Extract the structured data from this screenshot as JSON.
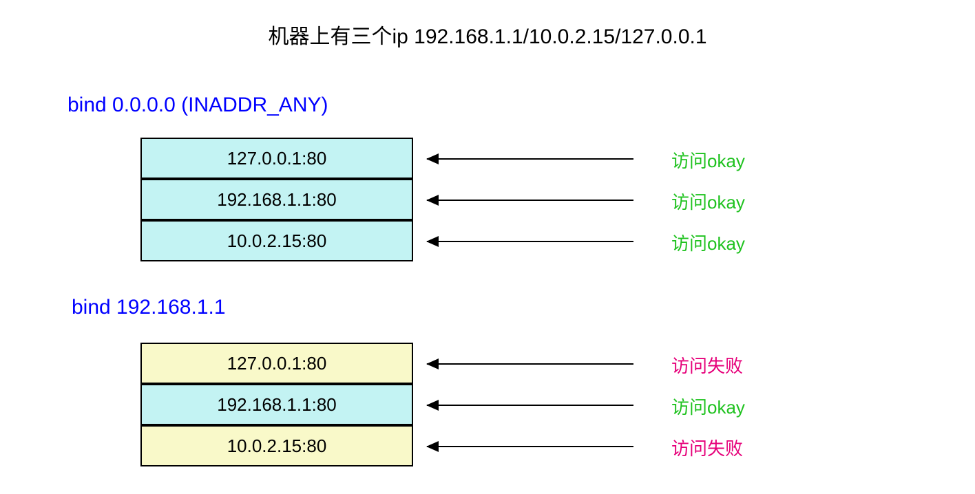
{
  "title": "机器上有三个ip 192.168.1.1/10.0.2.15/127.0.0.1",
  "section1": {
    "heading": "bind 0.0.0.0 (INADDR_ANY)",
    "rows": [
      {
        "addr": "127.0.0.1:80",
        "status": "访问okay",
        "ok": true
      },
      {
        "addr": "192.168.1.1:80",
        "status": "访问okay",
        "ok": true
      },
      {
        "addr": "10.0.2.15:80",
        "status": "访问okay",
        "ok": true
      }
    ]
  },
  "section2": {
    "heading": "bind 192.168.1.1",
    "rows": [
      {
        "addr": "127.0.0.1:80",
        "status": "访问失败",
        "ok": false
      },
      {
        "addr": "192.168.1.1:80",
        "status": "访问okay",
        "ok": true
      },
      {
        "addr": "10.0.2.15:80",
        "status": "访问失败",
        "ok": false
      }
    ]
  }
}
